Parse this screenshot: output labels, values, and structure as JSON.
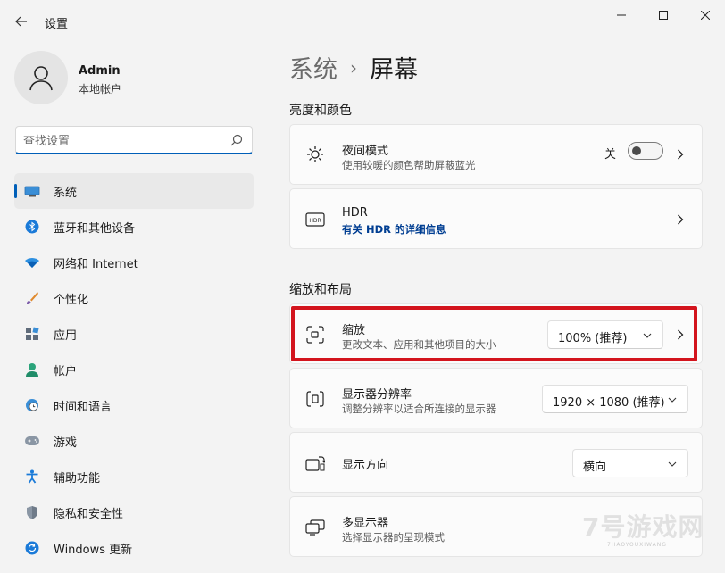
{
  "window": {
    "title": "设置",
    "controls": {
      "minimize": "minimize-icon",
      "maximize": "maximize-icon",
      "close": "close-icon"
    }
  },
  "profile": {
    "name": "Admin",
    "account_type": "本地帐户"
  },
  "search": {
    "placeholder": "查找设置",
    "value": ""
  },
  "sidebar": {
    "items": [
      {
        "label": "系统",
        "icon": "display-icon",
        "active": true
      },
      {
        "label": "蓝牙和其他设备",
        "icon": "bluetooth-icon",
        "active": false
      },
      {
        "label": "网络和 Internet",
        "icon": "wifi-icon",
        "active": false
      },
      {
        "label": "个性化",
        "icon": "brush-icon",
        "active": false
      },
      {
        "label": "应用",
        "icon": "apps-icon",
        "active": false
      },
      {
        "label": "帐户",
        "icon": "person-icon",
        "active": false
      },
      {
        "label": "时间和语言",
        "icon": "globe-clock-icon",
        "active": false
      },
      {
        "label": "游戏",
        "icon": "gamepad-icon",
        "active": false
      },
      {
        "label": "辅助功能",
        "icon": "accessibility-icon",
        "active": false
      },
      {
        "label": "隐私和安全性",
        "icon": "shield-icon",
        "active": false
      },
      {
        "label": "Windows 更新",
        "icon": "update-icon",
        "active": false
      }
    ]
  },
  "main": {
    "breadcrumb": {
      "parent": "系统",
      "separator": "›",
      "current": "屏幕"
    },
    "sections": {
      "brightness": "亮度和颜色",
      "scale_layout": "缩放和布局"
    },
    "night_light": {
      "title": "夜间模式",
      "subtitle": "使用较暖的颜色帮助屏蔽蓝光",
      "toggle_label": "关",
      "on": false
    },
    "hdr": {
      "title": "HDR",
      "link": "有关 HDR 的详细信息"
    },
    "scale": {
      "title": "缩放",
      "subtitle": "更改文本、应用和其他项目的大小",
      "value": "100% (推荐)"
    },
    "resolution": {
      "title": "显示器分辨率",
      "subtitle": "调整分辨率以适合所连接的显示器",
      "value": "1920 × 1080 (推荐)"
    },
    "orientation": {
      "title": "显示方向",
      "value": "横向"
    },
    "multi_display": {
      "title": "多显示器",
      "subtitle": "选择显示器的呈现模式"
    }
  },
  "watermark": {
    "text": "7号游戏网",
    "sub": "7HAOYOUXIWANG"
  },
  "colors": {
    "accent": "#005fb8",
    "highlight": "#d3141d",
    "link": "#003e92"
  }
}
